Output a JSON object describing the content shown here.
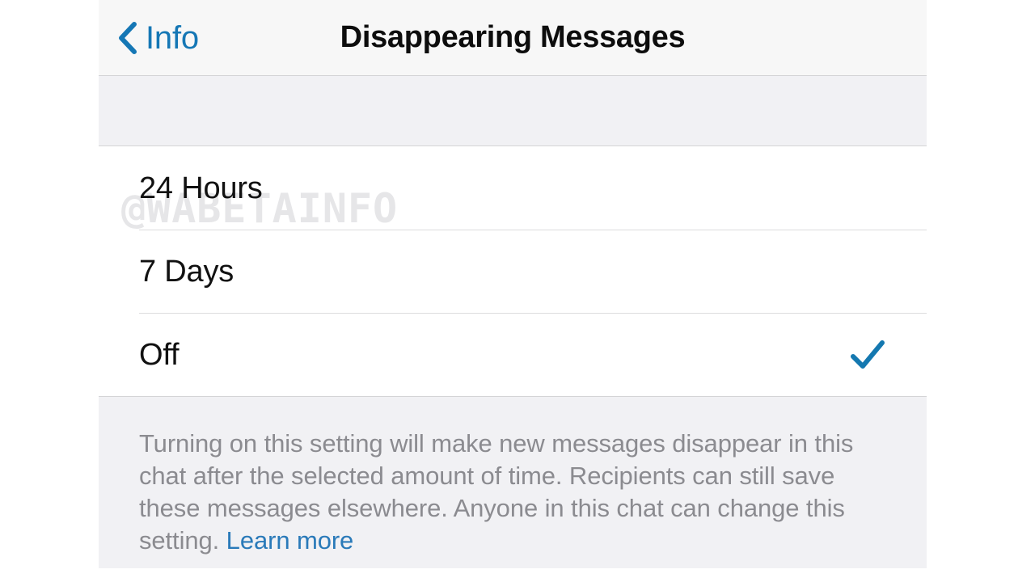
{
  "navbar": {
    "back_label": "Info",
    "back_icon": "chevron-left-icon",
    "title": "Disappearing Messages"
  },
  "watermark": {
    "text": "@WABETAINFO"
  },
  "options": [
    {
      "label": "24 Hours",
      "selected": false
    },
    {
      "label": "7 Days",
      "selected": false
    },
    {
      "label": "Off",
      "selected": true
    }
  ],
  "footer": {
    "text": "Turning on this setting will make new messages disappear in this chat after the selected amount of time. Recipients can still save these messages elsewhere. Anyone in this chat can change this setting. ",
    "link_label": "Learn more"
  },
  "colors": {
    "accent_blue": "#1577b5",
    "link_blue": "#2a7ab9",
    "check_blue": "#1478b0",
    "navbar_bg": "#f7f7f7",
    "group_bg": "#f1f1f4",
    "row_bg": "#ffffff",
    "separator": "#dcdcde",
    "label_text": "#111111",
    "footer_text": "#8b8b90",
    "watermark": "#e6e6e8"
  }
}
